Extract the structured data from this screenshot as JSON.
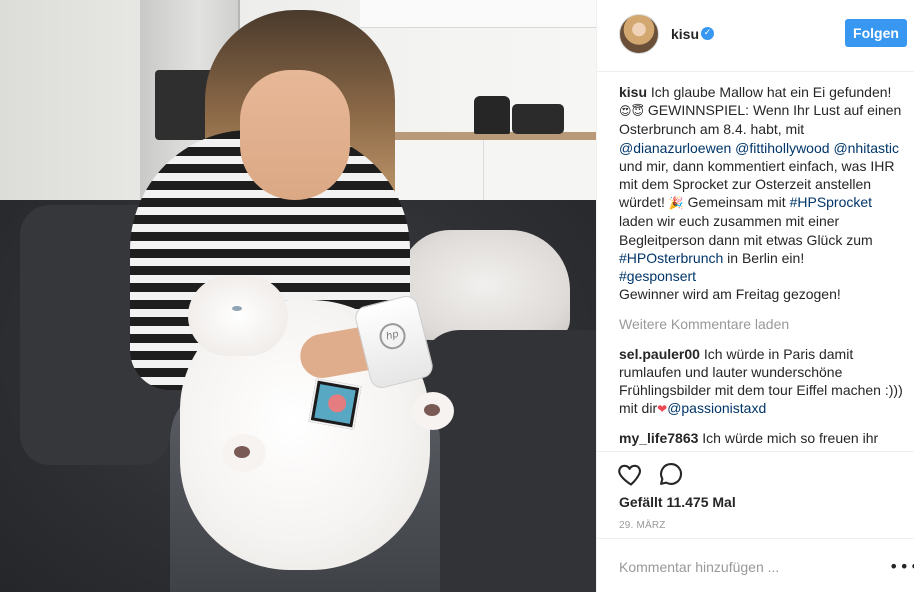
{
  "header": {
    "username": "kisu",
    "verified_icon": "verified-badge-icon",
    "follow_label": "Folgen"
  },
  "caption": {
    "username": "kisu",
    "text_1": "Ich glaube Mallow hat ein Ei gefunden!",
    "emoji_1": "😍😇",
    "text_2": "GEWINNSPIEL: Wenn Ihr Lust auf einen Osterbrunch am 8.4. habt, mit",
    "mention_1": "@dianazurloewen",
    "mention_2": "@fittihollywood",
    "mention_3": "@nhitastic",
    "text_3": "und mir, dann kommentiert einfach, was IHR mit dem Sprocket zur Osterzeit anstellen würdet!",
    "emoji_2": "🎉",
    "text_4": "Gemeinsam mit",
    "hashtag_1": "#HPSprocket",
    "text_5": "laden wir euch zusammen mit einer Begleitperson dann mit etwas Glück zum",
    "hashtag_2": "#HPOsterbrunch",
    "text_6": "in Berlin ein!",
    "hashtag_3": "#gesponsert",
    "text_7": "Gewinner wird am Freitag gezogen!"
  },
  "load_more_label": "Weitere Kommentare laden",
  "comments": [
    {
      "username": "sel.pauler00",
      "text": "Ich würde in Paris damit rumlaufen und lauter wunderschöne Frühlingsbilder mit dem tour Eiffel machen :))) mit dir",
      "emoji": "❤",
      "mention": "@passionistaxd"
    },
    {
      "username": "my_life7863",
      "text": "Ich würde mich so freuen ihr seid meine größten Idole ich habe überall"
    }
  ],
  "actions": {
    "like_icon": "heart-icon",
    "comment_icon": "comment-bubble-icon",
    "likes_text": "Gefällt 11.475 Mal",
    "date": "29. MÄRZ"
  },
  "add_comment": {
    "placeholder": "Kommentar hinzufügen ...",
    "more_icon": "more-options-icon",
    "more_glyph": "•••"
  },
  "photo": {
    "printer_logo": "hp",
    "description_icon": "post-photo"
  },
  "colors": {
    "accent": "#3897f0",
    "link": "#003569",
    "muted": "#999999",
    "text": "#262626"
  }
}
